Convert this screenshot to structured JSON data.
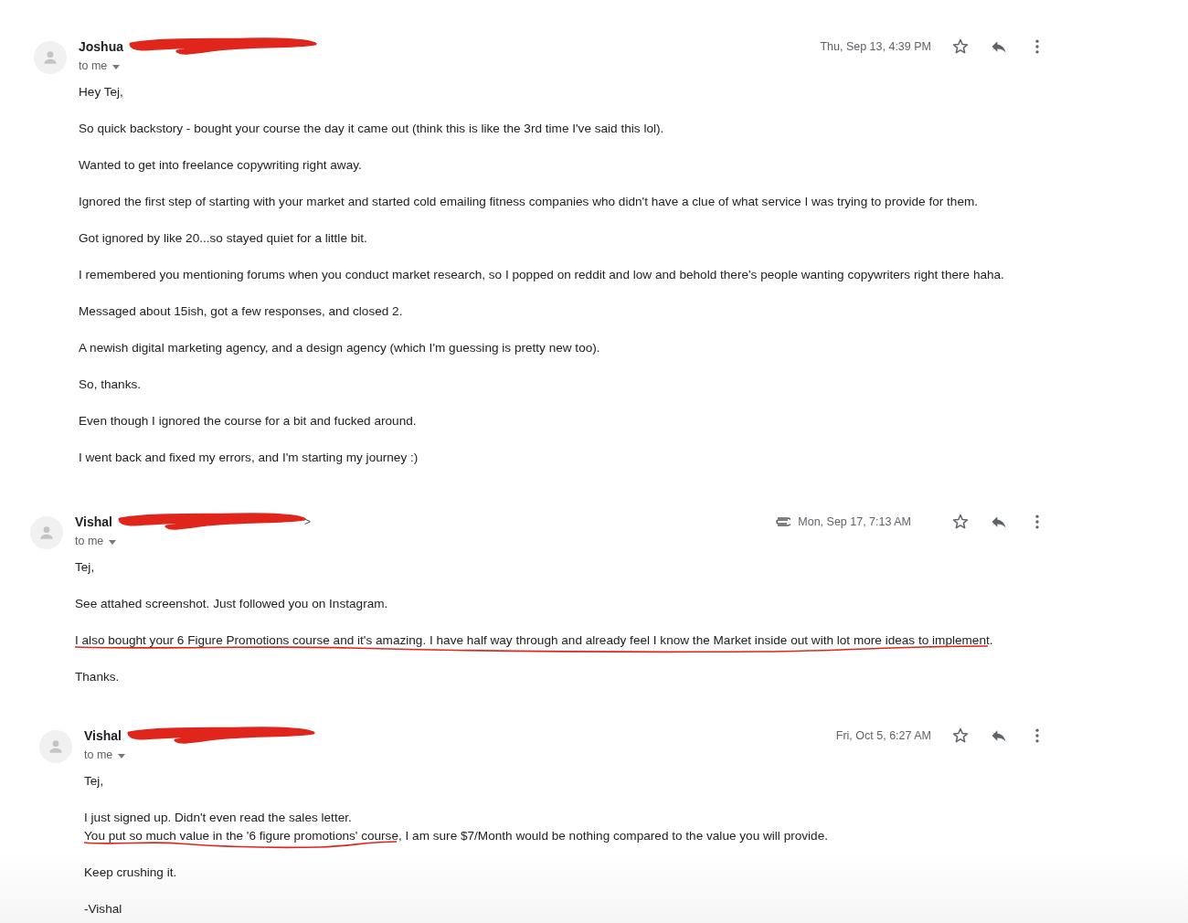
{
  "messages": [
    {
      "sender": {
        "name": "Joshua",
        "redacted": true
      },
      "recipient": "to me",
      "attachment": false,
      "date": "Thu, Sep 13, 4:39 PM",
      "starred": false,
      "paragraphs": [
        [
          [
            {
              "text": "Hey Tej,",
              "underlined": false
            }
          ]
        ],
        [
          [
            {
              "text": "So quick backstory - bought your course the day it came out (think this is like the 3rd time I've said this lol).",
              "underlined": false
            }
          ]
        ],
        [
          [
            {
              "text": "Wanted to get into freelance copywriting right away.",
              "underlined": false
            }
          ]
        ],
        [
          [
            {
              "text": "Ignored the first step of starting with your market and started cold emailing fitness companies who didn't have a clue of what service I was trying to provide for them.",
              "underlined": false
            }
          ]
        ],
        [
          [
            {
              "text": "Got ignored by like 20...so stayed quiet for a little bit.",
              "underlined": false
            }
          ]
        ],
        [
          [
            {
              "text": "I remembered you mentioning forums when you conduct market research, so I popped on reddit and low and behold there's people wanting copywriters right there haha.",
              "underlined": false
            }
          ]
        ],
        [
          [
            {
              "text": "Messaged about 15ish, got a few responses, and closed 2.",
              "underlined": false
            }
          ]
        ],
        [
          [
            {
              "text": "A newish digital marketing agency, and a design agency (which I'm guessing is pretty new too).",
              "underlined": false
            }
          ]
        ],
        [
          [
            {
              "text": "So, thanks.",
              "underlined": false
            }
          ]
        ],
        [
          [
            {
              "text": "Even though I ignored the course for a bit and fucked around.",
              "underlined": false
            }
          ]
        ],
        [
          [
            {
              "text": "I went back and fixed my errors, and I'm starting my journey :)",
              "underlined": false
            }
          ]
        ]
      ]
    },
    {
      "sender": {
        "name": "Vishal",
        "redacted": true,
        "address_tail": ">"
      },
      "recipient": "to me",
      "attachment": true,
      "date": "Mon, Sep 17, 7:13 AM",
      "starred": false,
      "paragraphs": [
        [
          [
            {
              "text": "Tej,",
              "underlined": false
            }
          ]
        ],
        [
          [
            {
              "text": "See attahed screenshot. Just followed you on Instagram.",
              "underlined": false
            }
          ]
        ],
        [
          [
            {
              "text": "I also bought your 6 Figure Promotions course and it's amazing. I have half way through and already feel I know the Market inside out with lot more ideas to implement",
              "underlined": true
            },
            {
              "text": ".",
              "underlined": false
            }
          ]
        ],
        [
          [
            {
              "text": "Thanks.",
              "underlined": false
            }
          ]
        ]
      ]
    },
    {
      "sender": {
        "name": "Vishal",
        "redacted": true
      },
      "recipient": "to me",
      "attachment": false,
      "date": "Fri, Oct 5, 6:27 AM",
      "starred": false,
      "paragraphs": [
        [
          [
            {
              "text": "Tej,",
              "underlined": false
            }
          ]
        ],
        [
          [
            {
              "text": "I just signed up. Didn't even read the sales letter.",
              "underlined": false
            }
          ],
          [
            {
              "text": "You put so much value in the '6 figure promotions' course",
              "underlined": true
            },
            {
              "text": ", I am sure $7/Month would be nothing compared to the value you will provide.",
              "underlined": false
            }
          ]
        ],
        [
          [
            {
              "text": "Keep crushing it.",
              "underlined": false
            }
          ]
        ],
        [
          [
            {
              "text": "-Vishal",
              "underlined": false
            }
          ]
        ]
      ]
    }
  ]
}
